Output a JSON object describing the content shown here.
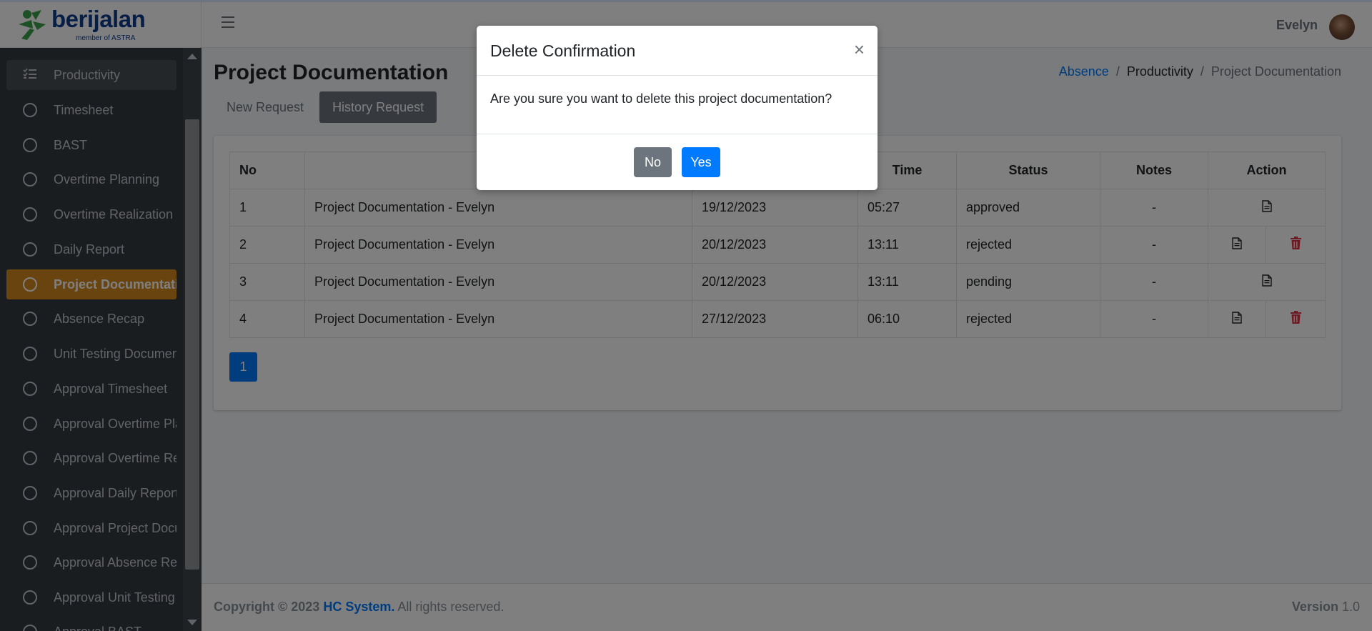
{
  "brand": {
    "name": "berijalan",
    "sub": "member of ASTRA"
  },
  "sidebar": {
    "items": [
      {
        "label": "Productivity",
        "type": "header"
      },
      {
        "label": "Timesheet"
      },
      {
        "label": "BAST"
      },
      {
        "label": "Overtime Planning"
      },
      {
        "label": "Overtime Realization"
      },
      {
        "label": "Daily Report"
      },
      {
        "label": "Project Documentation",
        "active": true
      },
      {
        "label": "Absence Recap"
      },
      {
        "label": "Unit Testing Document"
      },
      {
        "label": "Approval Timesheet"
      },
      {
        "label": "Approval Overtime Planning"
      },
      {
        "label": "Approval Overtime Realization"
      },
      {
        "label": "Approval Daily Report"
      },
      {
        "label": "Approval Project Documentation"
      },
      {
        "label": "Approval Absence Recap"
      },
      {
        "label": "Approval Unit Testing Document"
      },
      {
        "label": "Approval BAST"
      }
    ]
  },
  "header": {
    "user_name": "Evelyn"
  },
  "page": {
    "title": "Project Documentation",
    "breadcrumb": [
      "Absence",
      "Productivity",
      "Project Documentation"
    ],
    "separator": "/",
    "tabs": [
      "New Request",
      "History Request"
    ]
  },
  "table": {
    "columns": [
      "No",
      "",
      "",
      "Time",
      "Status",
      "Notes",
      "Action"
    ],
    "rows": [
      {
        "no": "1",
        "name": "Project Documentation - Evelyn",
        "date": "19/12/2023",
        "time": "05:27",
        "status": "approved",
        "notes": "-",
        "deletable": false
      },
      {
        "no": "2",
        "name": "Project Documentation - Evelyn",
        "date": "20/12/2023",
        "time": "13:11",
        "status": "rejected",
        "notes": "-",
        "deletable": true
      },
      {
        "no": "3",
        "name": "Project Documentation - Evelyn",
        "date": "20/12/2023",
        "time": "13:11",
        "status": "pending",
        "notes": "-",
        "deletable": false
      },
      {
        "no": "4",
        "name": "Project Documentation - Evelyn",
        "date": "27/12/2023",
        "time": "06:10",
        "status": "rejected",
        "notes": "-",
        "deletable": true
      }
    ]
  },
  "pagination": {
    "current": "1"
  },
  "footer": {
    "copyright": "Copyright © 2023",
    "brand": "HC System.",
    "rights": "All rights reserved.",
    "version_label": "Version",
    "version": "1.0"
  },
  "modal": {
    "title": "Delete Confirmation",
    "close": "×",
    "message": "Are you sure you want to delete this project documentation?",
    "no_label": "No",
    "yes_label": "Yes"
  },
  "colors": {
    "active": "#d4891e",
    "primary": "#007bff",
    "danger": "#dc3545",
    "brand": "#0f3d8c",
    "brand_green": "#3aa34a"
  }
}
